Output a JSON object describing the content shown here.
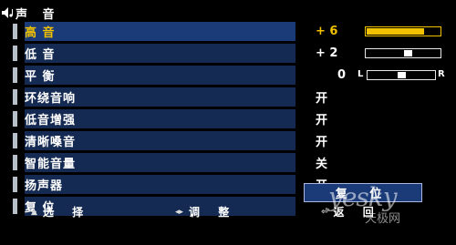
{
  "header": {
    "title": "声 音",
    "icon": "speaker-note-icon"
  },
  "menu": {
    "items": [
      {
        "label": "高 音",
        "selected": true
      },
      {
        "label": "低 音",
        "selected": false
      },
      {
        "label": "平 衡",
        "selected": false
      },
      {
        "label": "环绕音响",
        "selected": false
      },
      {
        "label": "低音增强",
        "selected": false
      },
      {
        "label": "清晰嗓音",
        "selected": false
      },
      {
        "label": "智能音量",
        "selected": false
      },
      {
        "label": "扬声器",
        "selected": false
      },
      {
        "label": "复 位",
        "selected": false
      }
    ]
  },
  "values": {
    "treble": {
      "text": "+ 6",
      "level": 0.75
    },
    "bass": {
      "text": "+ 2",
      "level": 0.58
    },
    "balance": {
      "text": "0",
      "left_label": "L",
      "right_label": "R",
      "level": 0.5
    },
    "surround": "开",
    "bass_boost": "开",
    "clear_voice": "开",
    "smart_volume": "关",
    "speaker": "开",
    "reset_button": "复 位"
  },
  "footer": {
    "select": {
      "icon": "up-down-icon",
      "label": "选 择"
    },
    "adjust": {
      "icon": "left-right-icon",
      "label": "调 整"
    },
    "back": {
      "icon": "return-icon",
      "label": "返 回"
    }
  },
  "watermark": {
    "line1": "yesky",
    "line2": "天极网"
  },
  "colors": {
    "background": "#000000",
    "bar": "#142a52",
    "selected": "#f2c200",
    "text": "#ffffff"
  }
}
